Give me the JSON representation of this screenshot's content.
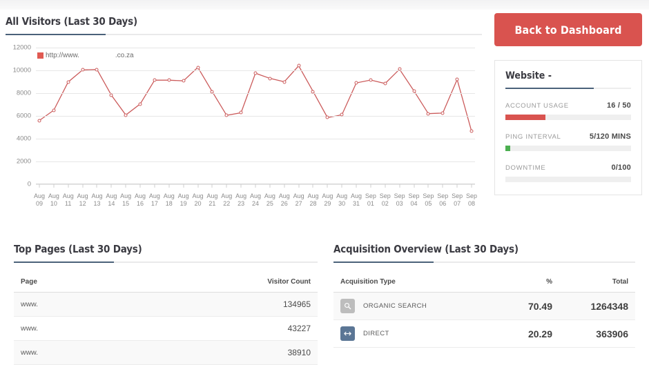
{
  "visitors_section": {
    "title": "All Visitors (Last 30 Days)",
    "legend_prefix": "http://www.",
    "legend_suffix": ".co.za"
  },
  "right_rail": {
    "back_button": "Back to Dashboard",
    "panel_title": "Website -",
    "metrics": [
      {
        "label": "ACCOUNT USAGE",
        "value": "16 / 50",
        "percent": 32,
        "color": "#d9534f"
      },
      {
        "label": "PING INTERVAL",
        "value": "5/120 MINS",
        "percent": 4,
        "color": "#4caf50"
      },
      {
        "label": "DOWNTIME",
        "value": "0/100",
        "percent": 0,
        "color": "#d9534f"
      }
    ]
  },
  "top_pages": {
    "title": "Top Pages (Last 30 Days)",
    "columns": [
      "Page",
      "Visitor Count"
    ],
    "rows": [
      {
        "page": "www.",
        "count": "134965"
      },
      {
        "page": "www.",
        "count": "43227"
      },
      {
        "page": "www.",
        "count": "38910"
      }
    ]
  },
  "acquisition": {
    "title": "Acquisition Overview (Last 30 Days)",
    "columns": [
      "Acquisition Type",
      "%",
      "Total"
    ],
    "rows": [
      {
        "icon": "search-icon",
        "icon_color": "#bdbdbd",
        "type": "ORGANIC SEARCH",
        "percent": "70.49",
        "total": "1264348"
      },
      {
        "icon": "direct-arrows-icon",
        "icon_color": "#5b7695",
        "type": "DIRECT",
        "percent": "20.29",
        "total": "363906"
      }
    ]
  },
  "chart_data": {
    "type": "line",
    "title": "All Visitors (Last 30 Days)",
    "xlabel": "",
    "ylabel": "",
    "ylim": [
      0,
      12000
    ],
    "yticks": [
      0,
      2000,
      4000,
      6000,
      8000,
      10000,
      12000
    ],
    "ytick_labels": [
      "0",
      "2000",
      "4000",
      "6000",
      "8000",
      "10000",
      "12000"
    ],
    "grid": true,
    "legend_position": "top-left",
    "line_color": "#cb5b5b",
    "categories": [
      "Aug 09",
      "Aug 10",
      "Aug 11",
      "Aug 12",
      "Aug 13",
      "Aug 14",
      "Aug 15",
      "Aug 16",
      "Aug 17",
      "Aug 18",
      "Aug 19",
      "Aug 20",
      "Aug 21",
      "Aug 22",
      "Aug 23",
      "Aug 24",
      "Aug 25",
      "Aug 26",
      "Aug 27",
      "Aug 28",
      "Aug 29",
      "Aug 30",
      "Aug 31",
      "Sep 01",
      "Sep 02",
      "Sep 03",
      "Sep 04",
      "Sep 05",
      "Sep 06",
      "Sep 07",
      "Sep 08"
    ],
    "series": [
      {
        "name": "http://www. .co.za",
        "values": [
          5600,
          6500,
          8980,
          10040,
          10080,
          7820,
          6080,
          7050,
          9140,
          9140,
          9080,
          10260,
          8130,
          6050,
          6280,
          9750,
          9300,
          9000,
          10400,
          8150,
          5850,
          6100,
          8900,
          9150,
          8850,
          10100,
          8200,
          6200,
          6250,
          9200,
          4650
        ]
      }
    ]
  }
}
